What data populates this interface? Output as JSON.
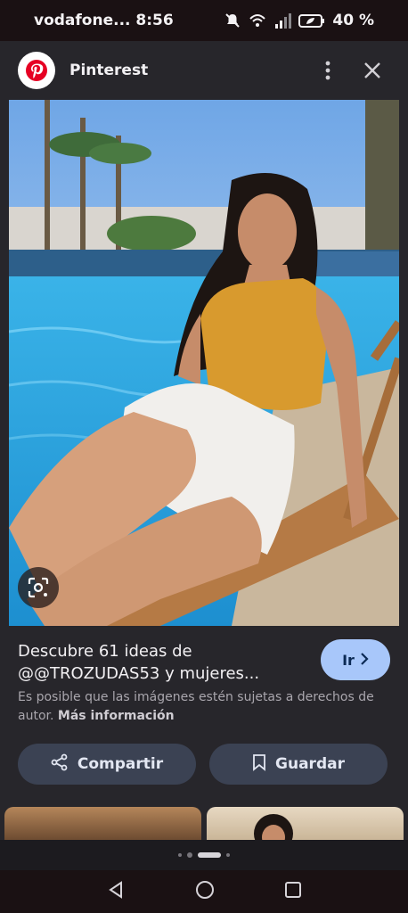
{
  "status_bar": {
    "carrier_time": "vodafone... 8:56",
    "battery": "40 %",
    "icons": [
      "mute-icon",
      "wifi-icon",
      "signal-icon",
      "battery-saver-icon"
    ]
  },
  "header": {
    "app_name": "Pinterest",
    "logo_icon": "pinterest-logo",
    "menu_icon": "more-vert-icon",
    "close_icon": "close-icon"
  },
  "image": {
    "lens_icon": "google-lens-icon"
  },
  "result": {
    "title": "Descubre 61 ideas de @@TROZUDAS53 y mujeres...",
    "go_button": "Ir",
    "copyright_text": "Es posible que las imágenes estén sujetas a derechos de autor.",
    "more_info": "Más información"
  },
  "actions": {
    "share_label": "Compartir",
    "save_label": "Guardar"
  },
  "colors": {
    "accent_button": "#a8c7fa",
    "action_button": "#3b4253",
    "panel": "#27262b"
  }
}
